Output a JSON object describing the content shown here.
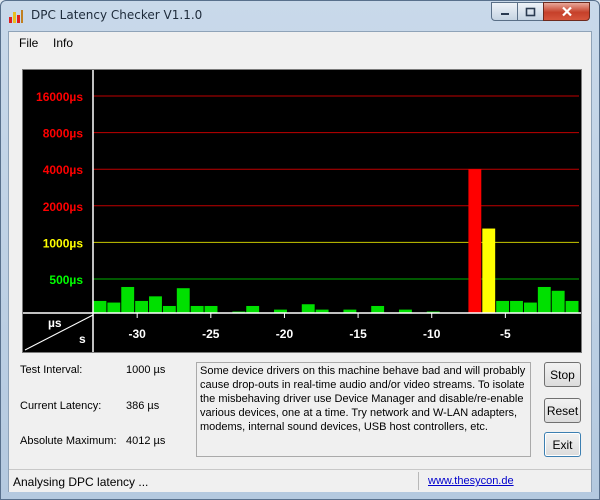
{
  "window": {
    "title": "DPC Latency Checker V1.1.0",
    "close_color": "#c6402a"
  },
  "menu": {
    "items": [
      "File",
      "Info"
    ]
  },
  "chart_data": {
    "type": "bar",
    "ylabel": "µs",
    "xlabel": "s",
    "y_ticks": [
      {
        "label": "16000µs",
        "color": "#ff0000"
      },
      {
        "label": "8000µs",
        "color": "#ff0000"
      },
      {
        "label": "4000µs",
        "color": "#ff0000"
      },
      {
        "label": "2000µs",
        "color": "#ff0000"
      },
      {
        "label": "1000µs",
        "color": "#ffff00"
      },
      {
        "label": "500µs",
        "color": "#00ff00"
      }
    ],
    "y_tick_values": [
      16000,
      8000,
      4000,
      2000,
      1000,
      500
    ],
    "x_ticks": [
      "-30",
      "-25",
      "-20",
      "-15",
      "-10",
      "-5"
    ],
    "x_tick_values": [
      -30,
      -25,
      -20,
      -15,
      -10,
      -5
    ],
    "x_range": [
      -33,
      0
    ],
    "log_scale": true,
    "bar_colors": {
      "ok": "#00e000",
      "warn": "#ffff00",
      "bad": "#ff0000"
    },
    "values": [
      330,
      320,
      430,
      330,
      360,
      300,
      420,
      300,
      300,
      260,
      270,
      300,
      260,
      280,
      250,
      310,
      280,
      260,
      280,
      260,
      300,
      260,
      280,
      250,
      270,
      260,
      250,
      4000,
      1300,
      330,
      330,
      320,
      430,
      400,
      330
    ]
  },
  "stats": {
    "test_interval_label": "Test Interval:",
    "test_interval_value": "1000 µs",
    "current_latency_label": "Current Latency:",
    "current_latency_value": "386 µs",
    "absolute_max_label": "Absolute Maximum:",
    "absolute_max_value": "4012 µs"
  },
  "info_text": "Some device drivers on this machine behave bad and will probably cause drop-outs in real-time audio and/or video streams. To isolate the misbehaving driver use Device Manager and disable/re-enable various devices, one at a time. Try network and W-LAN adapters, modems, internal sound devices, USB host controllers, etc.",
  "buttons": {
    "stop": "Stop",
    "reset": "Reset",
    "exit": "Exit"
  },
  "status": {
    "text": "Analysing DPC latency ...",
    "link": "www.thesycon.de"
  }
}
